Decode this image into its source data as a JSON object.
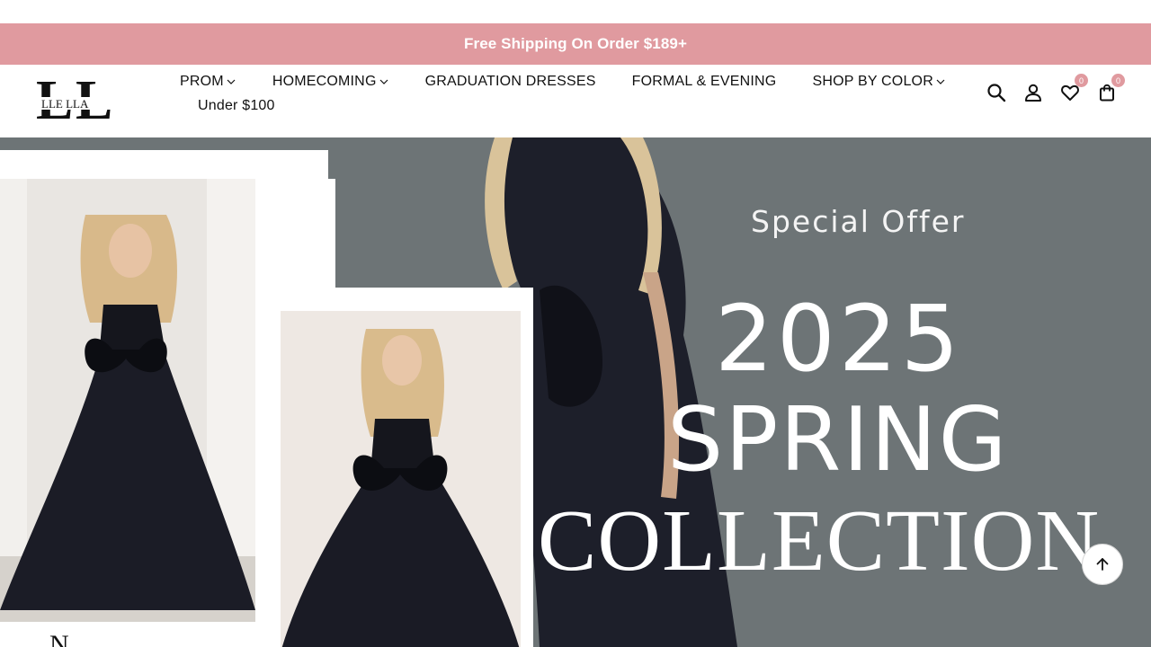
{
  "announcement": {
    "text": "Free Shipping On Order $189+"
  },
  "brand": {
    "logo_text": "LLE LLA",
    "accent_color": "#e09a9f"
  },
  "nav": {
    "items": [
      {
        "label": "PROM",
        "has_dropdown": true
      },
      {
        "label": "HOMECOMING",
        "has_dropdown": true
      },
      {
        "label": "GRADUATION DRESSES",
        "has_dropdown": false
      },
      {
        "label": "FORMAL & EVENING",
        "has_dropdown": false
      },
      {
        "label": "SHOP BY COLOR",
        "has_dropdown": true
      }
    ],
    "second_row": {
      "label": "Under $100"
    }
  },
  "header_icons": {
    "search": "search-icon",
    "account": "user-icon",
    "wishlist": {
      "icon": "heart-icon",
      "count": "0"
    },
    "cart": {
      "icon": "bag-icon",
      "count": "0"
    }
  },
  "hero": {
    "kicker": "Special Offer",
    "year": "2025",
    "line1": "SPRING",
    "line2": "COLLECTION",
    "card_letter": "N",
    "background_color": "#6d7476"
  },
  "back_to_top": {
    "icon": "arrow-up-icon"
  }
}
